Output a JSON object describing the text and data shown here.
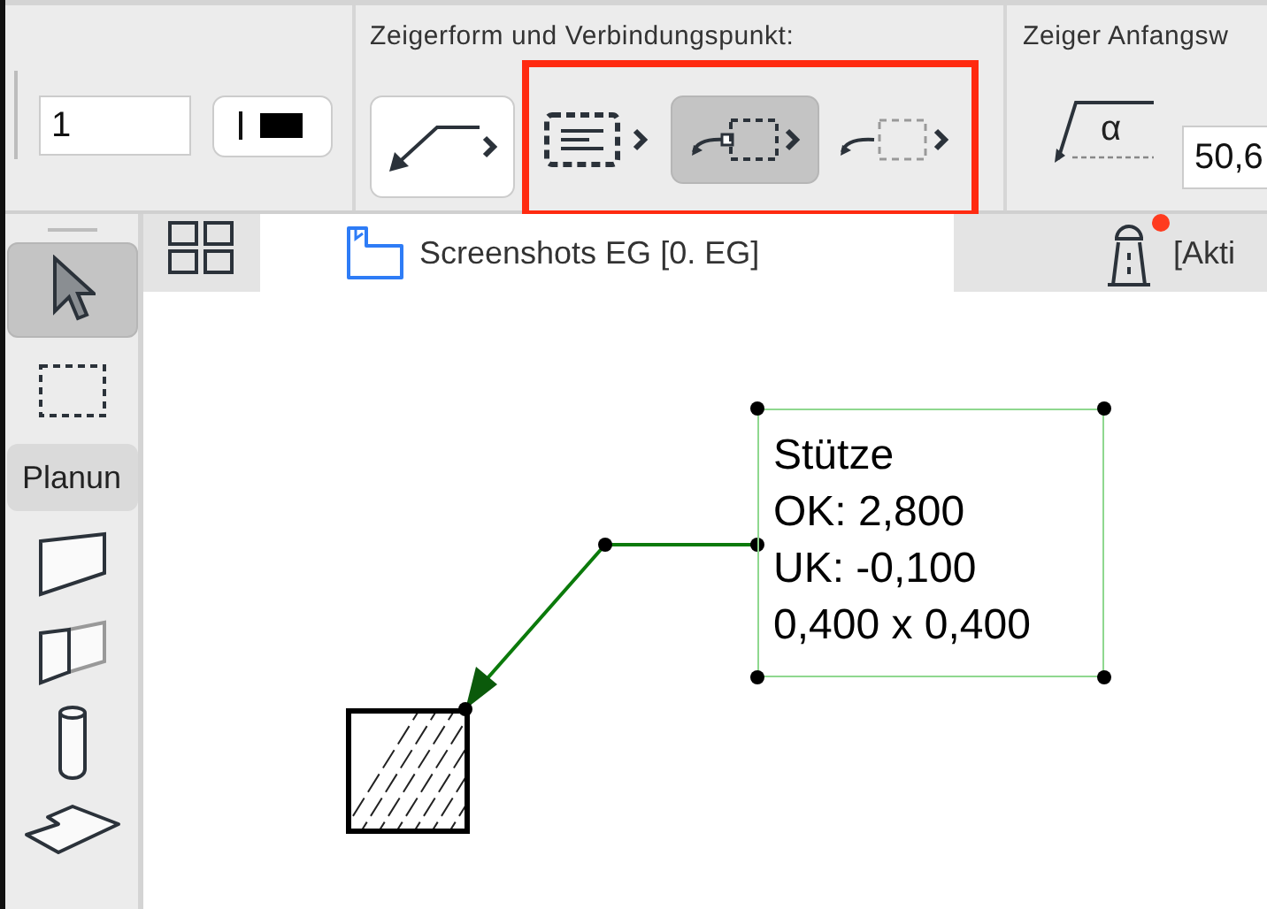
{
  "toolbar": {
    "pen_field": {
      "value": "1"
    },
    "pointer_section": {
      "title": "Zeigerform und Verbindungspunkt:",
      "highlighted": true,
      "options": [
        {
          "kind": "elbow",
          "selected": false
        },
        {
          "kind": "text-frame",
          "selected": false
        },
        {
          "kind": "anchor-frame",
          "selected": true
        },
        {
          "kind": "faint-frame",
          "selected": false
        }
      ]
    },
    "angle_section": {
      "title": "Zeiger Anfangsw",
      "angle_symbol": "α",
      "value": "50,6"
    }
  },
  "tabs": [
    {
      "kind": "plan",
      "label": "Screenshots EG [0. EG]",
      "selected": true,
      "notification": false
    },
    {
      "kind": "beacon",
      "label": "[Akti",
      "selected": false,
      "notification": true
    }
  ],
  "toolbox": [
    {
      "kind": "arrow",
      "selected": true
    },
    {
      "kind": "marquee",
      "selected": false
    },
    {
      "kind": "label",
      "label": "Planun",
      "selected": false
    },
    {
      "kind": "wall",
      "selected": false
    },
    {
      "kind": "window",
      "selected": false
    },
    {
      "kind": "column",
      "selected": false
    },
    {
      "kind": "slab",
      "selected": false
    }
  ],
  "label_box": {
    "lines": [
      "Stütze",
      "OK: 2,800",
      "UK: -0,100",
      "0,400 x 0,400"
    ]
  }
}
